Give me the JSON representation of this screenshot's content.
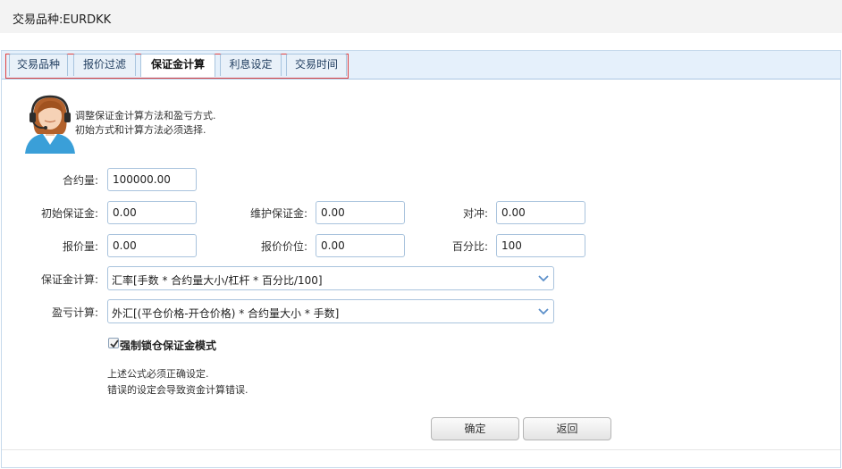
{
  "header": {
    "title": "交易品种:EURDKK"
  },
  "tabs": [
    "交易品种",
    "报价过滤",
    "保证金计算",
    "利息设定",
    "交易时间"
  ],
  "active_tab_index": 2,
  "hint": {
    "line1": "调整保证金计算方法和盈亏方式.",
    "line2": "初始方式和计算方法必须选择."
  },
  "form": {
    "contract_size": {
      "label": "合约量:",
      "value": "100000.00"
    },
    "initial_margin": {
      "label": "初始保证金:",
      "value": "0.00"
    },
    "maintenance_margin": {
      "label": "维护保证金:",
      "value": "0.00"
    },
    "hedged": {
      "label": "对冲:",
      "value": "0.00"
    },
    "quote_volume": {
      "label": "报价量:",
      "value": "0.00"
    },
    "quote_tick": {
      "label": "报价价位:",
      "value": "0.00"
    },
    "percentage": {
      "label": "百分比:",
      "value": "100"
    },
    "margin_calc": {
      "label": "保证金计算:",
      "value": "汇率[手数 * 合约量大小/杠杆 * 百分比/100]"
    },
    "profit_calc": {
      "label": "盈亏计算:",
      "value": "外汇[(平仓价格-开仓价格) * 合约量大小 * 手数]"
    },
    "force_lock_margin": {
      "label": "强制锁仓保证金模式",
      "checked": true
    }
  },
  "note": {
    "line1": "上述公式必须正确设定.",
    "line2": "错误的设定会导致资金计算错误."
  },
  "buttons": {
    "ok": "确定",
    "back": "返回"
  },
  "colors": {
    "tab_highlight_border": "#e04040",
    "tabbar_bg": "#e5f0fb",
    "input_border": "#a9c3dd"
  }
}
